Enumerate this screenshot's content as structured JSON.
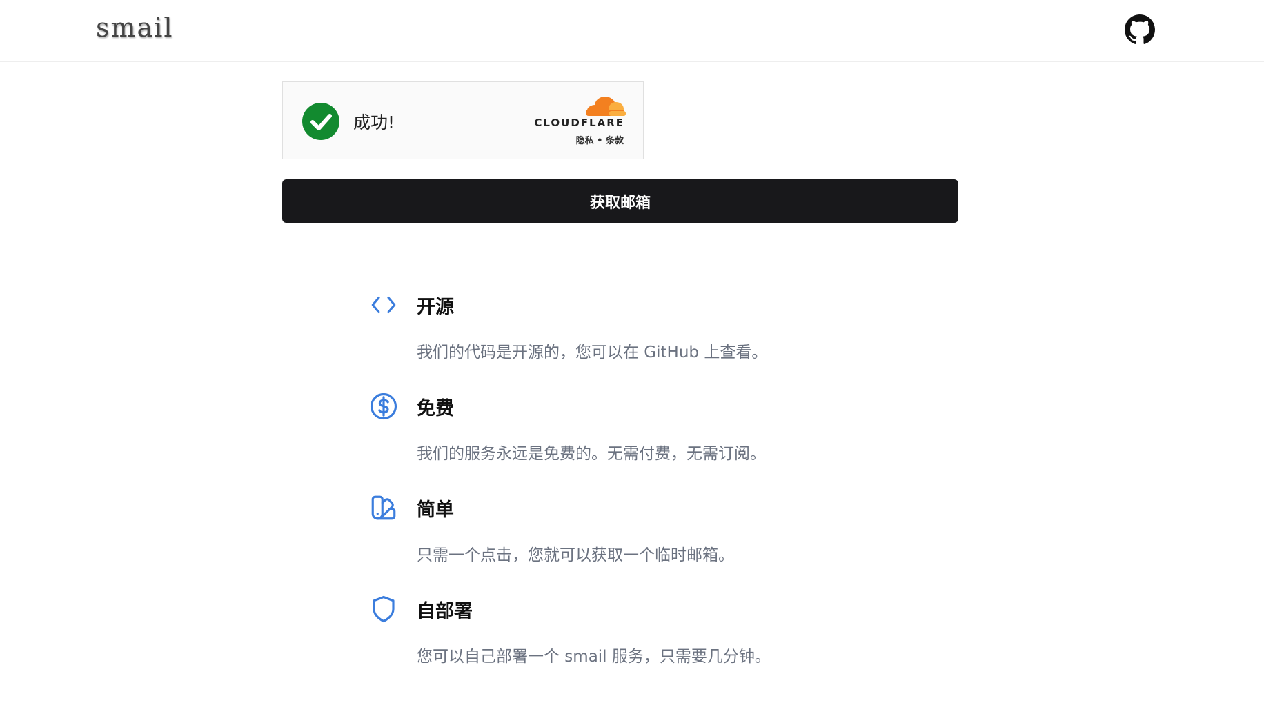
{
  "header": {
    "logo": "smail",
    "github_icon": "github-icon"
  },
  "captcha": {
    "status_text": "成功!",
    "brand": "CLOUDFLARE",
    "privacy_link": "隐私",
    "separator": "•",
    "terms_link": "条款",
    "check_color": "#128a2f",
    "cloud_color": "#f38020"
  },
  "get_email_button": "获取邮箱",
  "accent_color": "#3b7ddd",
  "features": [
    {
      "icon": "code-icon",
      "title": "开源",
      "description": "我们的代码是开源的，您可以在 GitHub 上查看。"
    },
    {
      "icon": "dollar-circle-icon",
      "title": "免费",
      "description": "我们的服务永远是免费的。无需付费，无需订阅。"
    },
    {
      "icon": "swatch-book-icon",
      "title": "简单",
      "description": "只需一个点击，您就可以获取一个临时邮箱。"
    },
    {
      "icon": "shield-icon",
      "title": "自部署",
      "description": "您可以自己部署一个 smail 服务，只需要几分钟。"
    }
  ]
}
